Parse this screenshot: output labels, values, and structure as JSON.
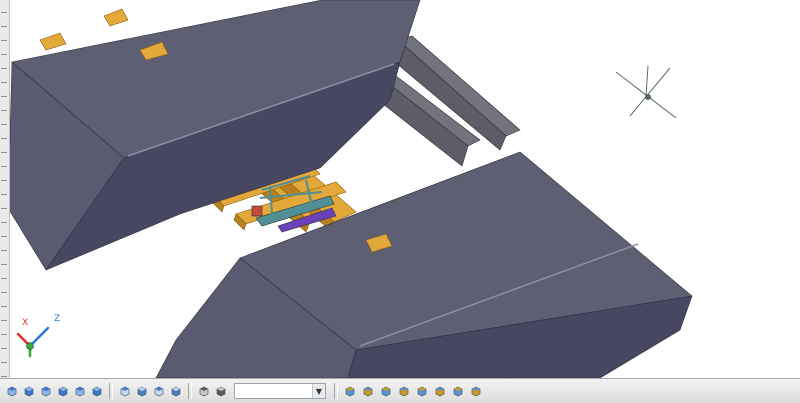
{
  "viewport": {
    "background": "#ffffff",
    "model_colors": {
      "slab_top": "#5f5f74",
      "slab_side": "#474762",
      "slab_end": "#5a5a70",
      "slab_edge_line": "#8f8fa3",
      "beam_top": "#73737d",
      "beam_side": "#5d5d68",
      "timber": "#e3a83a",
      "timber_dark": "#b8801f",
      "frame_steel": "#4f8f95",
      "frame_purple": "#6b41b8",
      "frame_red": "#c74a3a"
    },
    "ucs_icon": {
      "x_axis": "X",
      "z_axis": "Z",
      "x_color": "#e0302b",
      "y_color": "#2fae3a",
      "z_color": "#2a79d6"
    },
    "cursor_color": "#5a6e64"
  },
  "toolbar": {
    "group_views": [
      "top-view-icon",
      "bottom-view-icon",
      "left-view-icon",
      "right-view-icon",
      "front-view-icon",
      "back-view-icon"
    ],
    "group_iso": [
      "sw-iso-icon",
      "se-iso-icon",
      "ne-iso-icon",
      "nw-iso-icon"
    ],
    "group_camera": [
      "camera-icon",
      "named-views-icon"
    ],
    "view_dropdown_value": "",
    "group_display": [
      "layers-icon",
      "properties-icon",
      "match-properties-icon",
      "orbit-icon",
      "walk-icon",
      "fly-icon",
      "render-icon",
      "materials-icon"
    ]
  }
}
